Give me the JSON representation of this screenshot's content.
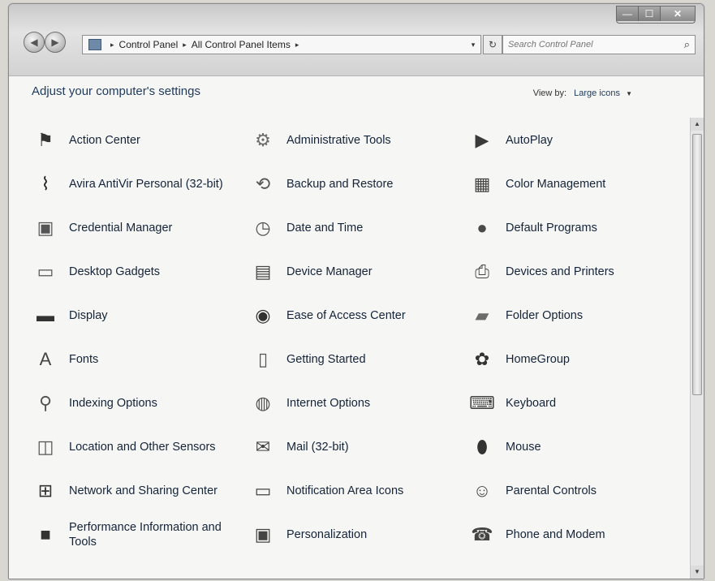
{
  "window": {
    "minimize": "—",
    "maximize": "☐",
    "close": "✕"
  },
  "nav": {
    "back": "◀",
    "forward": "▶"
  },
  "breadcrumb": [
    "Control Panel",
    "All Control Panel Items"
  ],
  "address": {
    "separator": "▸",
    "dropdown": "▾"
  },
  "refresh": "↻",
  "search": {
    "placeholder": "Search Control Panel",
    "icon": "⌕"
  },
  "heading": "Adjust your computer's settings",
  "view_by": {
    "label": "View by:",
    "value": "Large icons",
    "arrow": "▼"
  },
  "scroll": {
    "up": "▲",
    "down": "▼"
  },
  "items": [
    {
      "label": "Action Center",
      "icon": "flag-icon",
      "glyph": "⚑",
      "color": "#333333"
    },
    {
      "label": "Administrative Tools",
      "icon": "admin-tools-icon",
      "glyph": "⚙",
      "color": "#6b6b6b"
    },
    {
      "label": "AutoPlay",
      "icon": "autoplay-icon",
      "glyph": "▶",
      "color": "#3a3a3a"
    },
    {
      "label": "Avira AntiVir Personal (32-bit)",
      "icon": "avira-icon",
      "glyph": "⌇",
      "color": "#222222"
    },
    {
      "label": "Backup and Restore",
      "icon": "backup-icon",
      "glyph": "⟲",
      "color": "#555555"
    },
    {
      "label": "Color Management",
      "icon": "color-management-icon",
      "glyph": "▦",
      "color": "#444444"
    },
    {
      "label": "Credential Manager",
      "icon": "credential-icon",
      "glyph": "▣",
      "color": "#555555"
    },
    {
      "label": "Date and Time",
      "icon": "clock-icon",
      "glyph": "◷",
      "color": "#555555"
    },
    {
      "label": "Default Programs",
      "icon": "default-programs-icon",
      "glyph": "●",
      "color": "#4a4a4a"
    },
    {
      "label": "Desktop Gadgets",
      "icon": "gadgets-icon",
      "glyph": "▭",
      "color": "#555555"
    },
    {
      "label": "Device Manager",
      "icon": "device-manager-icon",
      "glyph": "▤",
      "color": "#444444"
    },
    {
      "label": "Devices and Printers",
      "icon": "printer-icon",
      "glyph": "⎙",
      "color": "#444444"
    },
    {
      "label": "Display",
      "icon": "display-icon",
      "glyph": "▬",
      "color": "#333333"
    },
    {
      "label": "Ease of Access Center",
      "icon": "ease-of-access-icon",
      "glyph": "◉",
      "color": "#333333"
    },
    {
      "label": "Folder Options",
      "icon": "folder-icon",
      "glyph": "▰",
      "color": "#6b6b6b"
    },
    {
      "label": "Fonts",
      "icon": "fonts-icon",
      "glyph": "A",
      "color": "#444444"
    },
    {
      "label": "Getting Started",
      "icon": "getting-started-icon",
      "glyph": "▯",
      "color": "#555555"
    },
    {
      "label": "HomeGroup",
      "icon": "homegroup-icon",
      "glyph": "✿",
      "color": "#333333"
    },
    {
      "label": "Indexing Options",
      "icon": "magnifier-icon",
      "glyph": "⚲",
      "color": "#555555"
    },
    {
      "label": "Internet Options",
      "icon": "internet-icon",
      "glyph": "◍",
      "color": "#555555"
    },
    {
      "label": "Keyboard",
      "icon": "keyboard-icon",
      "glyph": "⌨",
      "color": "#444444"
    },
    {
      "label": "Location and Other Sensors",
      "icon": "location-icon",
      "glyph": "◫",
      "color": "#555555"
    },
    {
      "label": "Mail (32-bit)",
      "icon": "mail-icon",
      "glyph": "✉",
      "color": "#444444"
    },
    {
      "label": "Mouse",
      "icon": "mouse-icon",
      "glyph": "⬮",
      "color": "#333333"
    },
    {
      "label": "Network and Sharing Center",
      "icon": "network-icon",
      "glyph": "⊞",
      "color": "#333333"
    },
    {
      "label": "Notification Area Icons",
      "icon": "notification-icon",
      "glyph": "▭",
      "color": "#444444"
    },
    {
      "label": "Parental Controls",
      "icon": "parental-controls-icon",
      "glyph": "☺",
      "color": "#444444"
    },
    {
      "label": "Performance Information and Tools",
      "icon": "performance-icon",
      "glyph": "■",
      "color": "#333333"
    },
    {
      "label": "Personalization",
      "icon": "personalization-icon",
      "glyph": "▣",
      "color": "#444444"
    },
    {
      "label": "Phone and Modem",
      "icon": "phone-icon",
      "glyph": "☎",
      "color": "#444444"
    }
  ]
}
